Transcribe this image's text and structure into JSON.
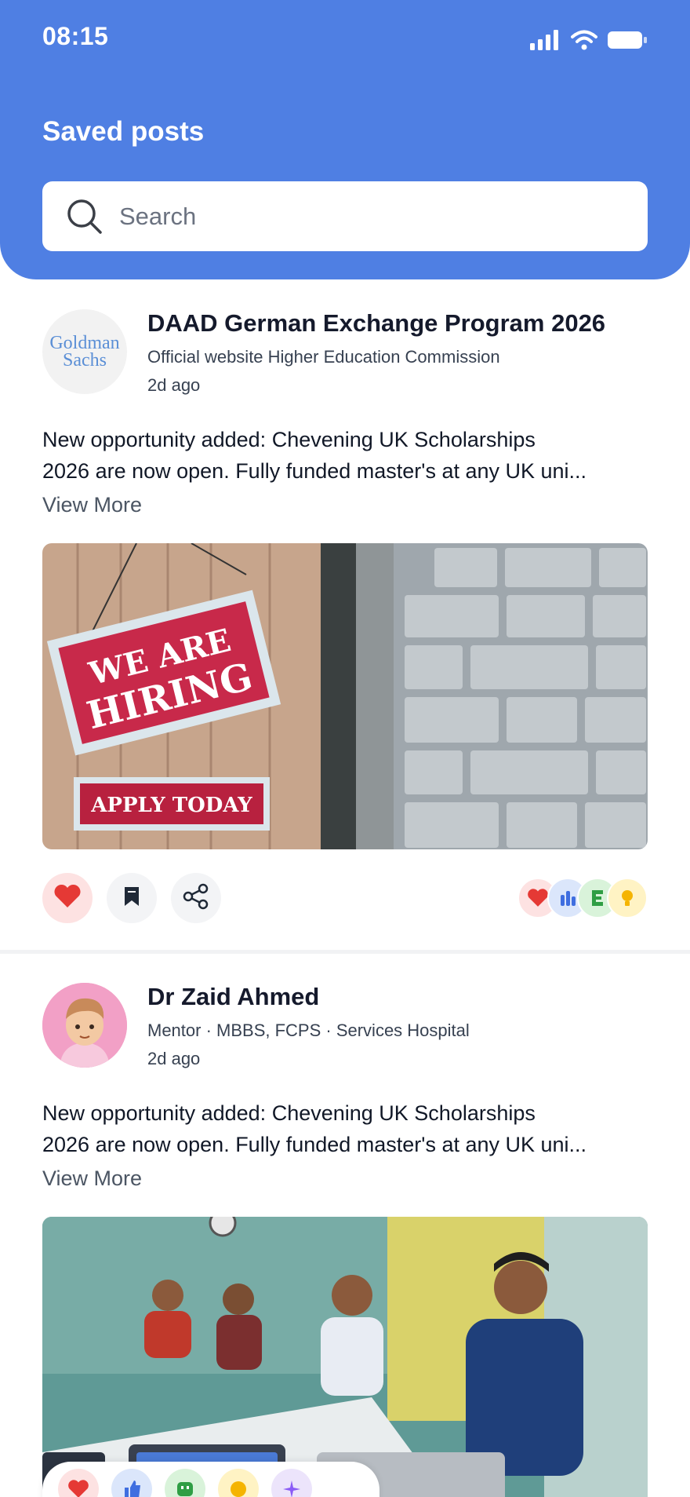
{
  "status": {
    "time": "08:15"
  },
  "header": {
    "title": "Saved posts"
  },
  "search": {
    "placeholder": "Search"
  },
  "posts": [
    {
      "avatar_text": [
        "Goldman",
        "Sachs"
      ],
      "title": "DAAD German Exchange Program 2026",
      "subtitle": "Official website Higher Education Commission",
      "time": "2d ago",
      "body_lines": [
        "New opportunity added: Chevening UK Scholarships",
        "2026 are now open. Fully funded master's at any UK uni..."
      ],
      "view_more": "View More",
      "image_text": {
        "line1": "WE ARE",
        "line2": "HIRING",
        "line3": "APPLY TODAY"
      },
      "reactions": [
        "heart",
        "clap",
        "celebrate",
        "idea"
      ]
    },
    {
      "title": "Dr Zaid Ahmed",
      "subtitle": "Mentor · MBBS, FCPS · Services Hospital",
      "time": "2d ago",
      "body_lines": [
        "New opportunity added: Chevening UK Scholarships",
        "2026 are now open. Fully funded master's at any UK uni..."
      ],
      "view_more": "View More",
      "reaction_picker": [
        "heart",
        "thumbs-up",
        "smile",
        "coin",
        "sparkle"
      ]
    }
  ],
  "colors": {
    "header_bg": "#4f7fe3",
    "like_red": "#e53935",
    "reaction_blue": "#dbe6fb",
    "reaction_green": "#d9f3da",
    "reaction_yellow": "#fff3c4"
  }
}
